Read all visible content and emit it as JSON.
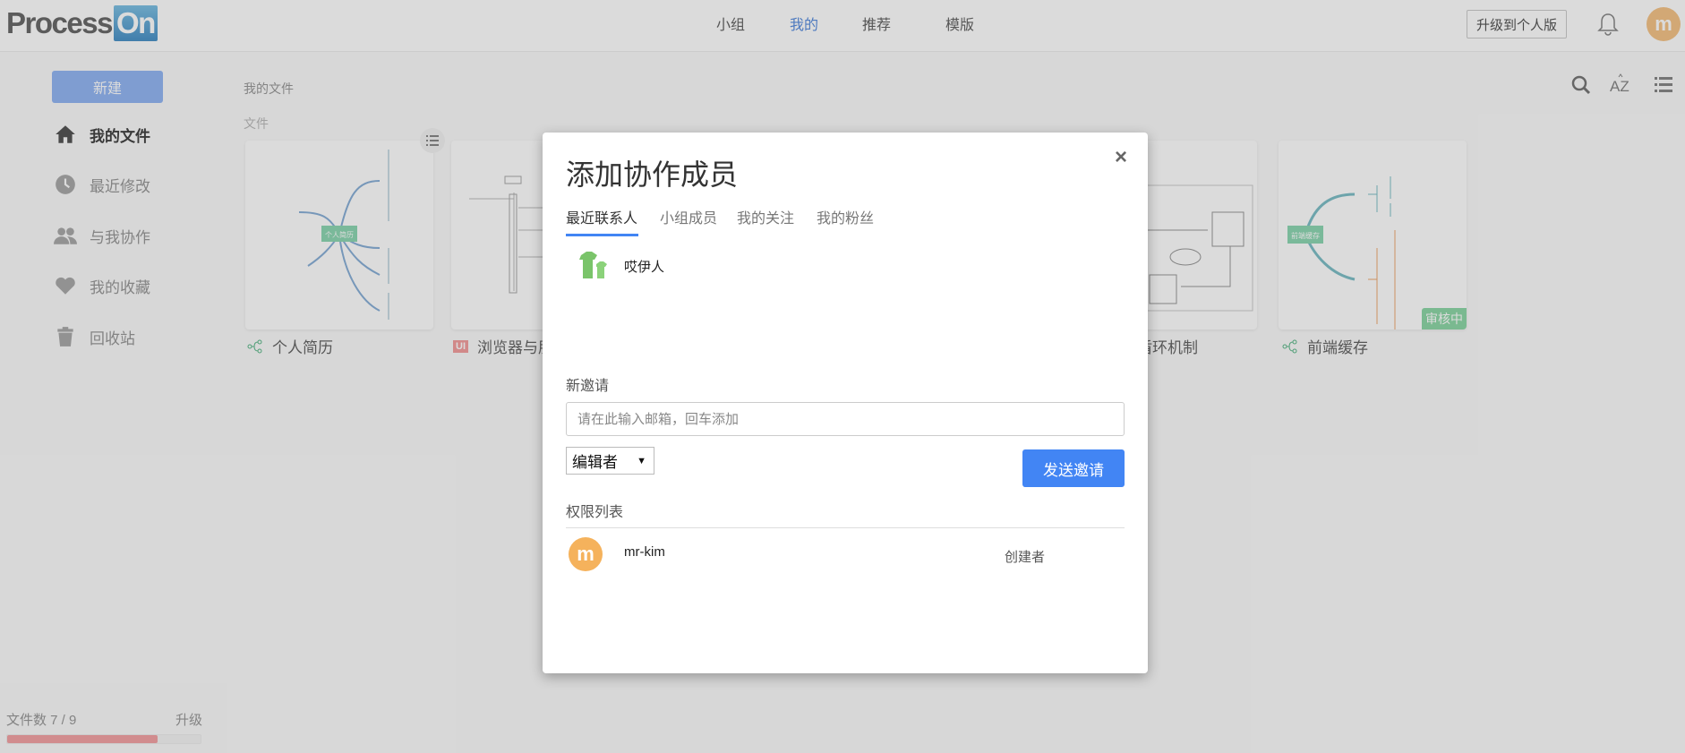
{
  "header": {
    "logo_text": "Process",
    "logo_on": "On",
    "nav": [
      {
        "label": "小组"
      },
      {
        "label": "我的",
        "active": true
      },
      {
        "label": "推荐"
      },
      {
        "label": "模版"
      }
    ],
    "upgrade_label": "升级到个人版",
    "avatar_letter": "m",
    "avatar_color": "#f5b25c"
  },
  "sidebar": {
    "new_label": "新建",
    "items": [
      {
        "label": "我的文件",
        "icon": "home-icon"
      },
      {
        "label": "最近修改",
        "icon": "clock-icon"
      },
      {
        "label": "与我协作",
        "icon": "users-icon"
      },
      {
        "label": "我的收藏",
        "icon": "heart-icon"
      },
      {
        "label": "回收站",
        "icon": "trash-icon"
      }
    ],
    "quota_label": "文件数 7 / 9",
    "quota_used": 7,
    "quota_total": 9,
    "upgrade_label": "升级",
    "quota_color": "#f4a4a6"
  },
  "main": {
    "breadcrumb": "我的文件",
    "section": "文件",
    "files": [
      {
        "title": "个人简历",
        "type": "mindmap"
      },
      {
        "title": "浏览器与朋",
        "type": "ui"
      },
      {
        "title": "",
        "type": "hidden"
      },
      {
        "title": "",
        "type": "hidden"
      },
      {
        "title": "盾环机制",
        "type": "flow"
      },
      {
        "title": "前端缓存",
        "type": "mindmap",
        "badge": "审核中"
      }
    ],
    "thumb_labels": {
      "resume_center": "个人简历",
      "cache_center": "前端缓存"
    }
  },
  "modal": {
    "title": "添加协作成员",
    "close": "×",
    "tabs": [
      {
        "label": "最近联系人",
        "active": true
      },
      {
        "label": "小组成员"
      },
      {
        "label": "我的关注"
      },
      {
        "label": "我的粉丝"
      }
    ],
    "contacts": [
      {
        "name": "哎伊人"
      }
    ],
    "new_invite_label": "新邀请",
    "email_placeholder": "请在此输入邮箱，回车添加",
    "role_value": "编辑者",
    "send_label": "发送邀请",
    "permissions_label": "权限列表",
    "members": [
      {
        "avatar_letter": "m",
        "name": "mr-kim",
        "role": "创建者"
      }
    ],
    "accent": "#4285f4"
  }
}
